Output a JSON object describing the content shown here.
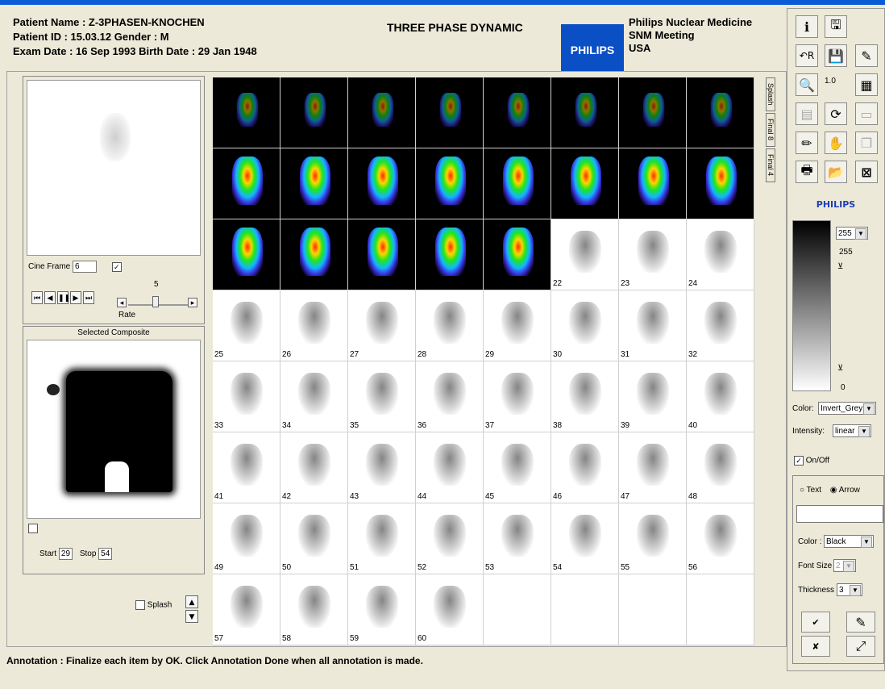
{
  "header": {
    "patient_name": "Patient Name : Z-3PHASEN-KNOCHEN",
    "patient_id": "Patient ID     : 15.03.12     Gender : M",
    "exam_date": "Exam Date     : 16 Sep 1993     Birth Date : 29 Jan 1948",
    "title": "THREE PHASE DYNAMIC",
    "brand": "PHILIPS",
    "site_line1": "Philips Nuclear Medicine",
    "site_line2": "SNM Meeting",
    "site_line3": "USA"
  },
  "left": {
    "cine_label": "Cine Frame",
    "cine_value": "6",
    "rate_value": "5",
    "rate_label": "Rate",
    "selected_composite": "Selected Composite",
    "start_label": "Start",
    "start_value": "29",
    "stop_label": "Stop",
    "stop_value": "54",
    "splash_label": "Splash"
  },
  "tabs": [
    "Splash",
    "Final 8",
    "Final 4"
  ],
  "frames": [
    {
      "label": "",
      "mode": "color"
    },
    {
      "label": "",
      "mode": "color"
    },
    {
      "label": "",
      "mode": "color"
    },
    {
      "label": "",
      "mode": "color"
    },
    {
      "label": "",
      "mode": "color"
    },
    {
      "label": "",
      "mode": "color"
    },
    {
      "label": "",
      "mode": "color"
    },
    {
      "label": "",
      "mode": "color"
    },
    {
      "label": "",
      "mode": "color"
    },
    {
      "label": "",
      "mode": "color"
    },
    {
      "label": "",
      "mode": "color"
    },
    {
      "label": "",
      "mode": "color"
    },
    {
      "label": "",
      "mode": "color"
    },
    {
      "label": "",
      "mode": "color"
    },
    {
      "label": "",
      "mode": "color"
    },
    {
      "label": "",
      "mode": "color"
    },
    {
      "label": "",
      "mode": "color"
    },
    {
      "label": "",
      "mode": "color"
    },
    {
      "label": "",
      "mode": "color"
    },
    {
      "label": "",
      "mode": "color"
    },
    {
      "label": "",
      "mode": "color"
    },
    {
      "label": "22",
      "mode": "grey"
    },
    {
      "label": "23",
      "mode": "grey"
    },
    {
      "label": "24",
      "mode": "grey"
    },
    {
      "label": "25",
      "mode": "grey"
    },
    {
      "label": "26",
      "mode": "grey"
    },
    {
      "label": "27",
      "mode": "grey"
    },
    {
      "label": "28",
      "mode": "grey"
    },
    {
      "label": "29",
      "mode": "grey"
    },
    {
      "label": "30",
      "mode": "grey"
    },
    {
      "label": "31",
      "mode": "grey"
    },
    {
      "label": "32",
      "mode": "grey"
    },
    {
      "label": "33",
      "mode": "grey"
    },
    {
      "label": "34",
      "mode": "grey"
    },
    {
      "label": "35",
      "mode": "grey"
    },
    {
      "label": "36",
      "mode": "grey"
    },
    {
      "label": "37",
      "mode": "grey"
    },
    {
      "label": "38",
      "mode": "grey"
    },
    {
      "label": "39",
      "mode": "grey"
    },
    {
      "label": "40",
      "mode": "grey"
    },
    {
      "label": "41",
      "mode": "grey"
    },
    {
      "label": "42",
      "mode": "grey"
    },
    {
      "label": "43",
      "mode": "grey"
    },
    {
      "label": "44",
      "mode": "grey"
    },
    {
      "label": "45",
      "mode": "grey"
    },
    {
      "label": "46",
      "mode": "grey"
    },
    {
      "label": "47",
      "mode": "grey"
    },
    {
      "label": "48",
      "mode": "grey"
    },
    {
      "label": "49",
      "mode": "grey"
    },
    {
      "label": "50",
      "mode": "grey"
    },
    {
      "label": "51",
      "mode": "grey"
    },
    {
      "label": "52",
      "mode": "grey"
    },
    {
      "label": "53",
      "mode": "grey"
    },
    {
      "label": "54",
      "mode": "grey"
    },
    {
      "label": "55",
      "mode": "grey"
    },
    {
      "label": "56",
      "mode": "grey"
    },
    {
      "label": "57",
      "mode": "grey"
    },
    {
      "label": "58",
      "mode": "grey"
    },
    {
      "label": "59",
      "mode": "grey"
    },
    {
      "label": "60",
      "mode": "grey"
    },
    {
      "label": "",
      "mode": "empty"
    },
    {
      "label": "",
      "mode": "empty"
    },
    {
      "label": "",
      "mode": "empty"
    },
    {
      "label": "",
      "mode": "empty"
    }
  ],
  "right": {
    "zoom_value": "1.0",
    "brand_text": "PHILIPS",
    "level_top": "255",
    "level_top_select": "255",
    "level_bottom": "0",
    "color_label": "Color:",
    "color_value": "Invert_Grey",
    "intensity_label": "Intensity:",
    "intensity_value": "linear",
    "onoff_label": "On/Off",
    "text_label": "Text",
    "arrow_label": "Arrow",
    "annot_color_label": "Color :",
    "annot_color_value": "Black",
    "font_size_label": "Font Size",
    "font_size_value": "2",
    "thickness_label": "Thickness",
    "thickness_value": "3"
  },
  "status": "Annotation : Finalize each item by OK. Click Annotation Done when all annotation is made."
}
